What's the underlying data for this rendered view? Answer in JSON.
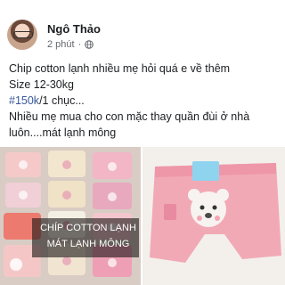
{
  "post": {
    "author": "Ngô Thảo",
    "time": "2 phút",
    "privacy_icon": "globe-icon",
    "text": {
      "line1": "Chip cotton lạnh nhiều mẹ hỏi quá e về thêm",
      "line2": "Size 12-30kg",
      "hashtag": "#150k",
      "line3_rest": "/1 chục...",
      "line4": "Nhiều mẹ mua cho con mặc thay quần đùi ở nhà",
      "line5": "luôn....mát lạnh mông"
    }
  },
  "photos": {
    "left": {
      "caption_line1": "CHÍP COTTON LẠNH",
      "caption_line2": "MÁT LẠNH MÔNG"
    }
  },
  "colors": {
    "hashtag": "#385898",
    "background": "#ffffff",
    "meta": "#65676b"
  }
}
